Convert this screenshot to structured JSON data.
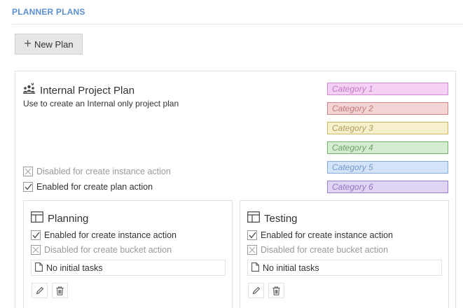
{
  "section": {
    "title": "PLANNER PLANS"
  },
  "toolbar": {
    "new_plan_label": "New Plan"
  },
  "plan": {
    "title": "Internal Project Plan",
    "description": "Use to create an Internal only project plan",
    "create_instance_flag": "Disabled for create instance action",
    "create_plan_flag": "Enabled for create plan action",
    "categories": [
      {
        "label": "Category 1",
        "bg": "#f4d0f4",
        "border": "#d28ad2",
        "color": "#c07ac0"
      },
      {
        "label": "Category 2",
        "bg": "#f4d4d4",
        "border": "#cc8888",
        "color": "#c07878"
      },
      {
        "label": "Category 3",
        "bg": "#f7f0cc",
        "border": "#c8b868",
        "color": "#b0a060"
      },
      {
        "label": "Category 4",
        "bg": "#d4ecd0",
        "border": "#78b070",
        "color": "#70a068"
      },
      {
        "label": "Category 5",
        "bg": "#d4e4f8",
        "border": "#88aadd",
        "color": "#7898cc"
      },
      {
        "label": "Category 6",
        "bg": "#e0d4f4",
        "border": "#9a80cc",
        "color": "#9078c0"
      }
    ]
  },
  "buckets": [
    {
      "title": "Planning",
      "create_instance_flag": "Enabled for create instance action",
      "create_bucket_flag": "Disabled for create bucket action",
      "tasks_label": "No initial tasks"
    },
    {
      "title": "Testing",
      "create_instance_flag": "Enabled for create instance action",
      "create_bucket_flag": "Disabled for create bucket action",
      "tasks_label": "No initial tasks"
    }
  ]
}
